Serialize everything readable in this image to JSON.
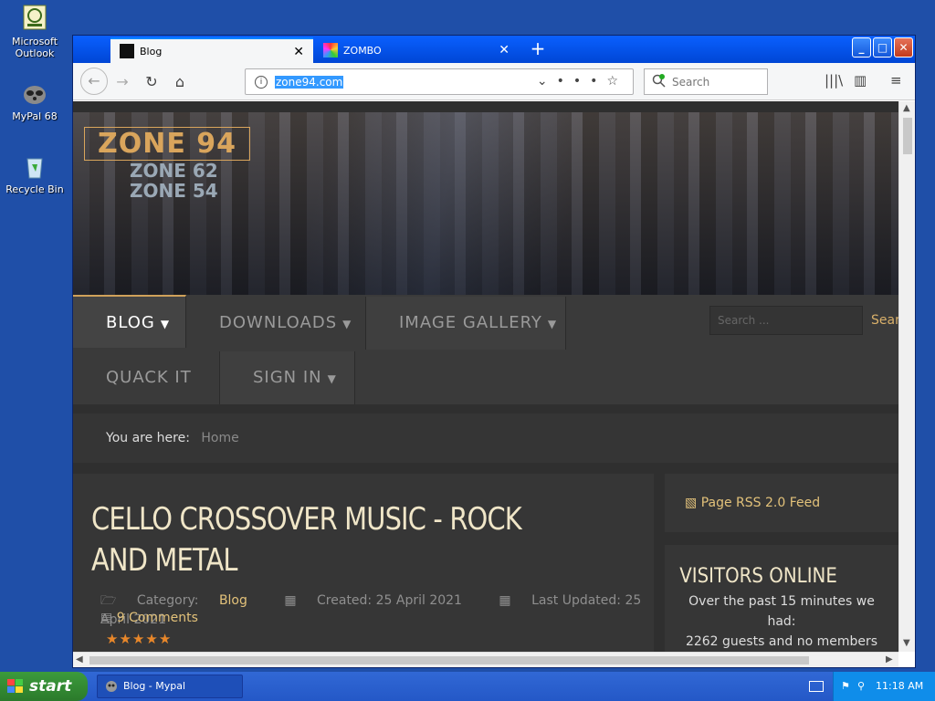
{
  "desktop": {
    "icons": [
      {
        "label": "Microsoft Outlook",
        "line1": "Microsoft",
        "line2": "Outlook"
      },
      {
        "label": "MyPal 68"
      },
      {
        "label": "Recycle Bin"
      }
    ]
  },
  "browser": {
    "tabs": [
      {
        "label": "Blog",
        "active": true
      },
      {
        "label": "ZOMBO",
        "active": false
      }
    ],
    "url": "zone94.com",
    "search_placeholder": "Search"
  },
  "site": {
    "logo": {
      "main": "ZONE 94",
      "sub1": "ZONE 62",
      "sub2": "ZONE 54"
    },
    "menu": [
      {
        "label": "BLOG",
        "caret": true,
        "active": true
      },
      {
        "label": "DOWNLOADS",
        "caret": true
      },
      {
        "label": "IMAGE GALLERY",
        "caret": true
      },
      {
        "label": "QUACK IT",
        "caret": false
      },
      {
        "label": "SIGN IN",
        "caret": true
      }
    ],
    "search_placeholder": "Search ...",
    "search_button": "Search",
    "breadcrumb": {
      "label": "You are here:",
      "home": "Home"
    },
    "article": {
      "title": "CELLO CROSSOVER MUSIC - ROCK AND METAL",
      "category_label": "Category:",
      "category": "Blog",
      "created": "Created: 25 April 2021",
      "updated": "Last Updated: 25 April 2021",
      "comments": "9 Comments",
      "rating_stars": 5
    },
    "sidebar": {
      "rss": "Page RSS 2.0 Feed",
      "visitors_title": "VISITORS ONLINE",
      "visitors_text1": "Over the past 15 minutes we had:",
      "visitors_text2": "2262 guests and no members"
    }
  },
  "taskbar": {
    "start": "start",
    "task": "Blog - Mypal",
    "clock": "11:18 AM"
  },
  "colors": {
    "desktop": "#1f4fa8",
    "accent_gold": "#e3c27a",
    "title_cream": "#f0e6c8",
    "star_orange": "#e8872a"
  }
}
